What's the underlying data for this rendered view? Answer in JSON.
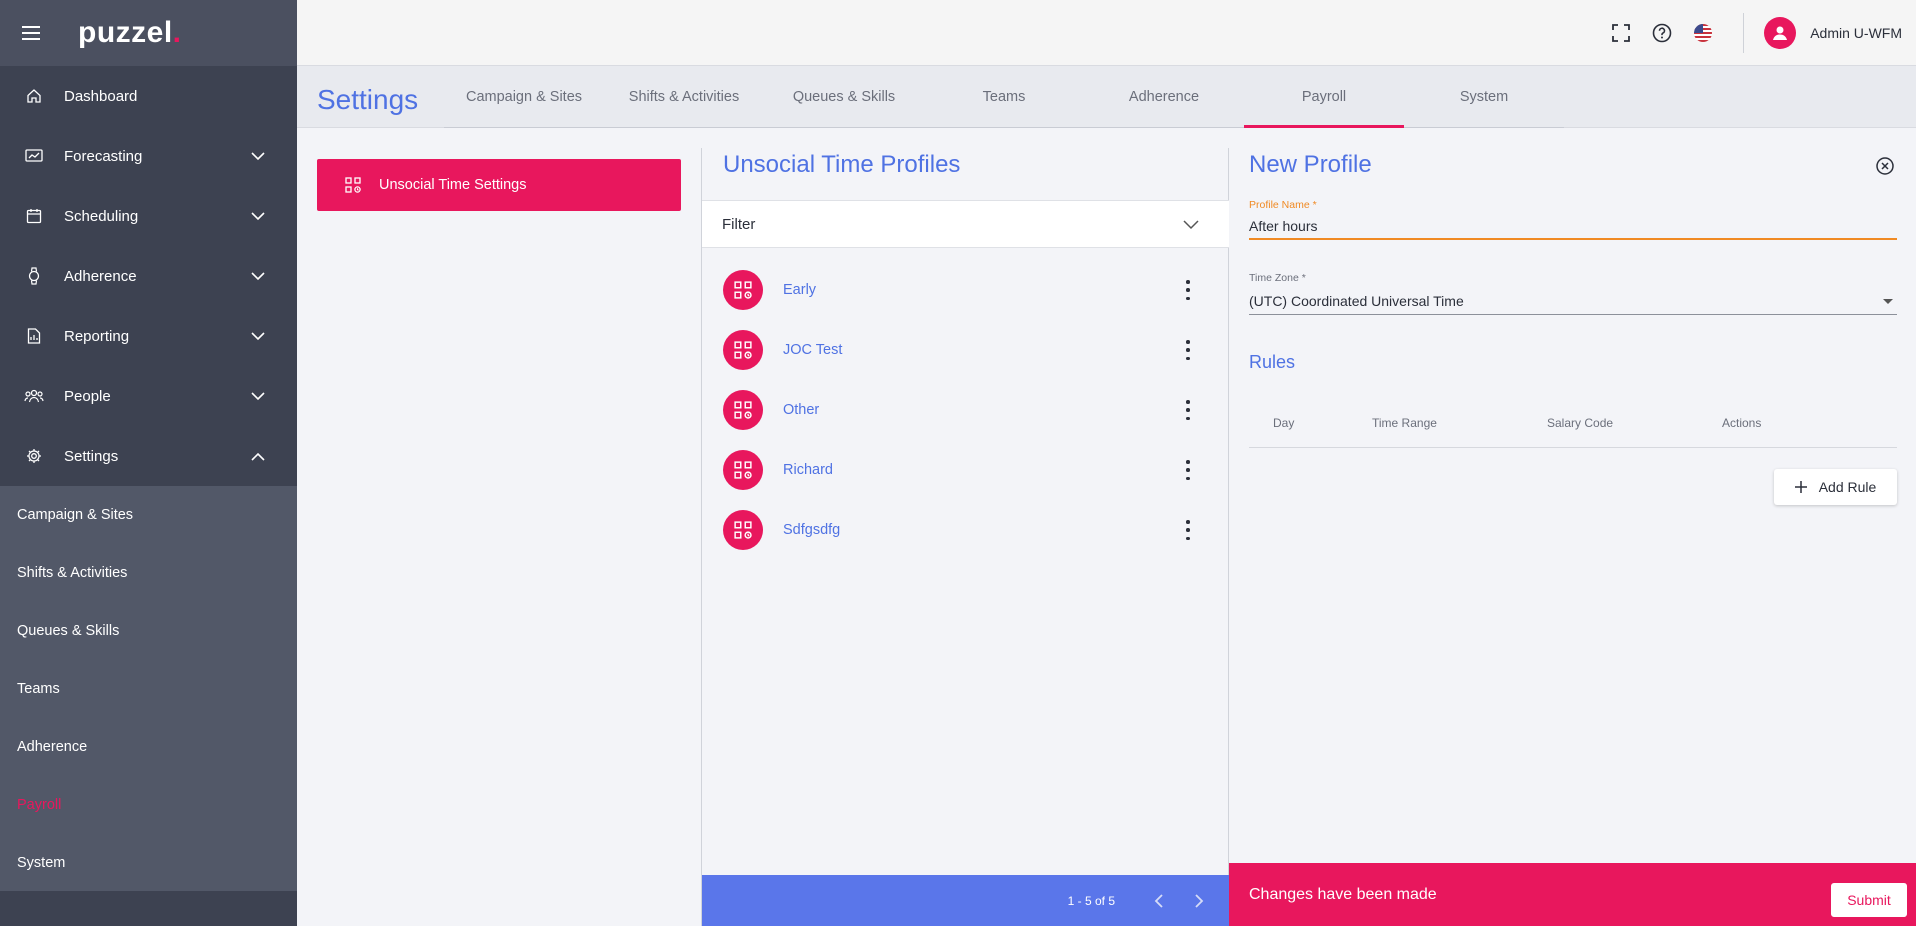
{
  "app": {
    "logo_text": "puzzel",
    "logo_dot": ".",
    "user_name": "Admin U-WFM"
  },
  "sidebar": {
    "items": [
      {
        "label": "Dashboard",
        "icon": "home-icon",
        "expandable": false
      },
      {
        "label": "Forecasting",
        "icon": "chart-icon",
        "expandable": true
      },
      {
        "label": "Scheduling",
        "icon": "calendar-icon",
        "expandable": true
      },
      {
        "label": "Adherence",
        "icon": "watch-icon",
        "expandable": true
      },
      {
        "label": "Reporting",
        "icon": "report-icon",
        "expandable": true
      },
      {
        "label": "People",
        "icon": "people-icon",
        "expandable": true
      },
      {
        "label": "Settings",
        "icon": "gear-icon",
        "expandable": true,
        "expanded": true
      }
    ],
    "sub_items": [
      {
        "label": "Campaign & Sites",
        "active": false
      },
      {
        "label": "Shifts & Activities",
        "active": false
      },
      {
        "label": "Queues & Skills",
        "active": false
      },
      {
        "label": "Teams",
        "active": false
      },
      {
        "label": "Adherence",
        "active": false
      },
      {
        "label": "Payroll",
        "active": true
      },
      {
        "label": "System",
        "active": false
      }
    ]
  },
  "settings": {
    "title": "Settings",
    "tabs": [
      {
        "label": "Campaign & Sites",
        "active": false
      },
      {
        "label": "Shifts & Activities",
        "active": false
      },
      {
        "label": "Queues & Skills",
        "active": false
      },
      {
        "label": "Teams",
        "active": false
      },
      {
        "label": "Adherence",
        "active": false
      },
      {
        "label": "Payroll",
        "active": true
      },
      {
        "label": "System",
        "active": false
      }
    ],
    "left_button": "Unsocial Time Settings"
  },
  "profiles": {
    "title": "Unsocial Time Profiles",
    "filter_label": "Filter",
    "items": [
      "Early",
      "JOC Test",
      "Other",
      "Richard",
      "Sdfgsdfg"
    ],
    "pager_range": "1 - 5 of 5"
  },
  "new_profile": {
    "title": "New Profile",
    "profile_name_label": "Profile Name *",
    "profile_name_value": "After hours",
    "time_zone_label": "Time Zone *",
    "time_zone_value": "(UTC) Coordinated Universal Time",
    "rules_title": "Rules",
    "rules_columns": [
      "Day",
      "Time Range",
      "Salary Code",
      "Actions"
    ],
    "add_rule_label": "Add Rule",
    "changes_text": "Changes have been made",
    "submit_label": "Submit"
  },
  "colors": {
    "brand_pink": "#e8175d",
    "accent_blue": "#4f72e3",
    "pager_blue": "#5a76ea",
    "sidebar_dark": "#3d4251",
    "input_focus_orange": "#f08a24"
  }
}
